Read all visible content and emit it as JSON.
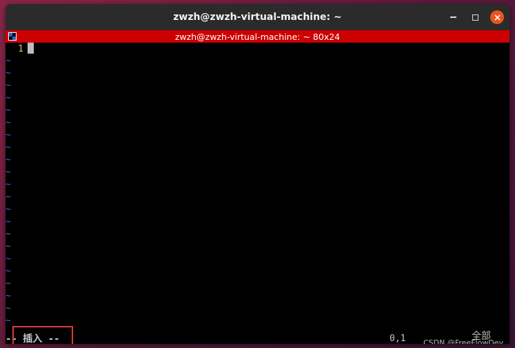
{
  "window": {
    "title": "zwzh@zwzh-virtual-machine: ~",
    "controls": {
      "minimize_icon": "minimize-icon",
      "maximize_icon": "maximize-icon",
      "close_icon": "close-icon"
    }
  },
  "tmux": {
    "status": "zwzh@zwzh-virtual-machine: ~ 80x24"
  },
  "editor": {
    "line_number": "1",
    "tilde": "~",
    "mode": "-- 插入 --",
    "cursor_position": "0,1",
    "scroll_position": "全部"
  },
  "watermark": "CSDN @FreeFlowDev",
  "colors": {
    "titlebar": "#2b2b2b",
    "tmux_bar": "#cc0000",
    "close_button": "#e9541f",
    "tilde": "#3c6bd6",
    "line_number": "#e5c35f",
    "highlight_box": "#e03a3a"
  }
}
